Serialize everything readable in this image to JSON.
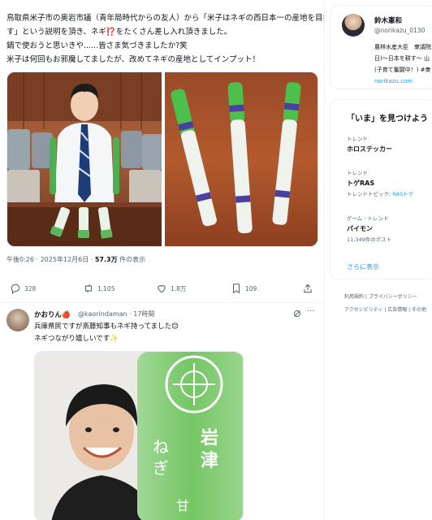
{
  "post": {
    "text_lines": [
      "鳥取県米子市の奥岩市議（青年局時代からの友人）から「米子はネギの西日本一の産地を目指",
      "す」という説明を頂き、ネギ",
      "をたくさん差し入れ頂きました。",
      "鍋で使おうと思いきや......皆さま気づきましたか?笑",
      "米子は何回もお邪魔してましたが、改めてネギの産地としてインプット！"
    ],
    "emoji_exclaim": "⁉️",
    "time": "午後0:26 · 2025年12月6日 · ",
    "views_count": "57.3万",
    "views_label": " 件の表示",
    "actions": {
      "reply_count": "328",
      "retweet_count": "1,105",
      "like_count": "1.8万",
      "bookmark_count": "109"
    }
  },
  "reply": {
    "name": "かおりん",
    "name_emoji": "🍎",
    "handle": "@kaorindaman · 17時間",
    "more": "···",
    "lines": [
      "兵庫県民ですが斎藤知事もネギ持ってました😊",
      "ネギつながり嬉しいです✨"
    ],
    "photo_label_1": "岩",
    "photo_label_2": "津",
    "photo_label_3": "ね",
    "photo_label_4": "ぎ",
    "photo_label_5": "甘"
  },
  "profile": {
    "name": "鈴木憲和",
    "handle": "@norikazu_0130",
    "bio_lines": [
      "農林水産大臣　衆議院",
      "日)〜日本を耕す〜 山",
      "(子育て奮闘中！) #衆"
    ],
    "link": "norikazu.com"
  },
  "trends": {
    "title": "「いま」を見つけよう",
    "items": [
      {
        "meta": "トレンド",
        "name": "ホロステッカー",
        "sub": "",
        "sub_link": ""
      },
      {
        "meta": "トレンド",
        "name": "トゲRAS",
        "sub": "トレンドトピック: ",
        "sub_link": "RASトゲ"
      },
      {
        "meta": "ゲーム · トレンド",
        "name": "パイモン",
        "sub": "11,349件のポスト",
        "sub_link": ""
      }
    ],
    "show_more": "さらに表示"
  },
  "footer": {
    "row1": [
      "利用規約",
      "プライバシーポリシー"
    ],
    "row2": [
      "アクセシビリティ",
      "広告情報",
      "その他"
    ]
  },
  "colors": {
    "accent": "#1d9bf0",
    "text": "#0f1419",
    "muted": "#536471",
    "border": "#eff3f4"
  }
}
